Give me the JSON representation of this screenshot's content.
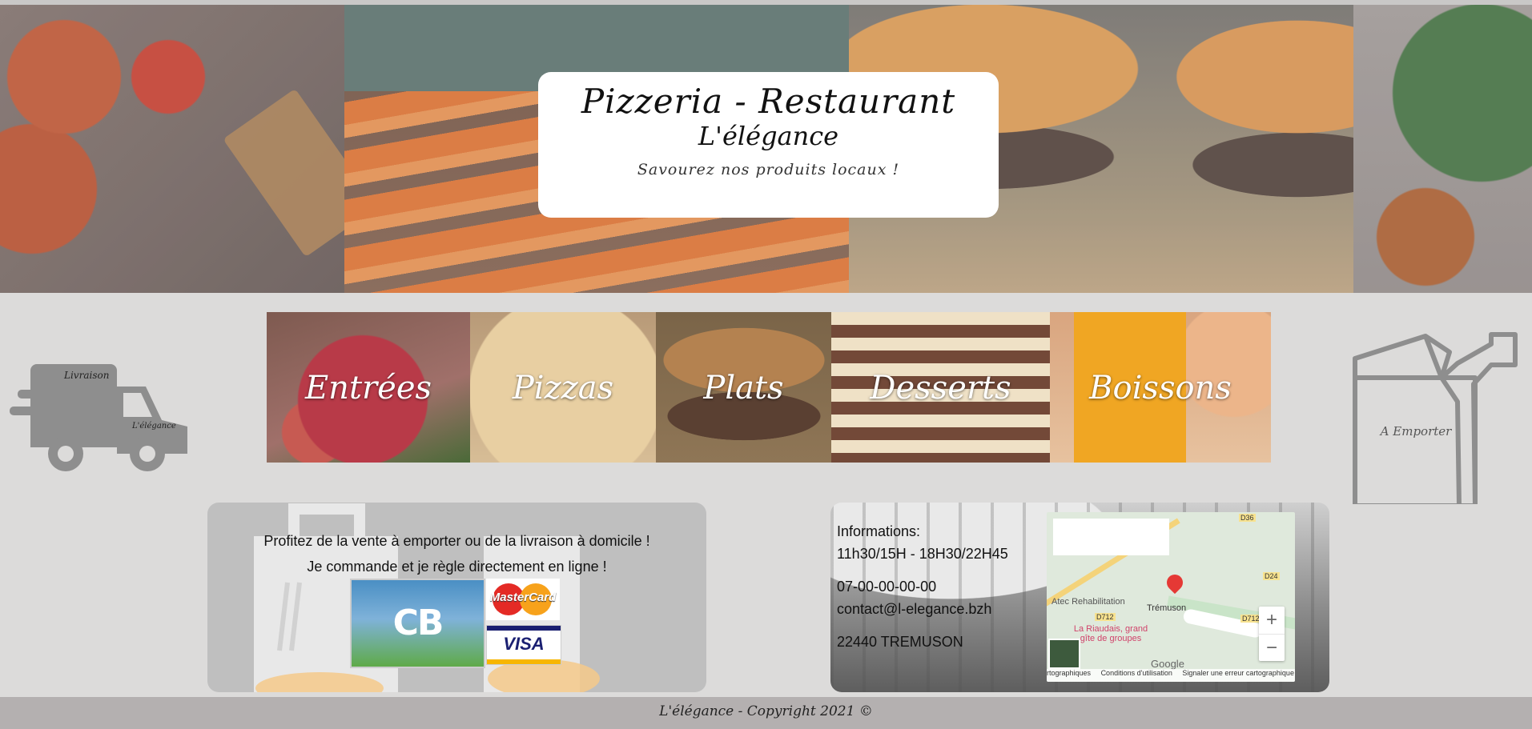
{
  "hero": {
    "title": "Pizzeria - Restaurant",
    "subtitle": "L'élégance",
    "tagline": "Savourez nos produits locaux !"
  },
  "categories": [
    {
      "label": "Entrées"
    },
    {
      "label": "Pizzas"
    },
    {
      "label": "Plats"
    },
    {
      "label": "Desserts"
    },
    {
      "label": "Boissons"
    }
  ],
  "delivery": {
    "line1": "Livraison",
    "line2": "L'élégance"
  },
  "takeaway": {
    "label": "A Emporter"
  },
  "order": {
    "line1": "Profitez de la vente à emporter ou de la livraison à domicile !",
    "line2": "Je commande et je règle directement en ligne !",
    "cards": {
      "cb": "CB",
      "mastercard": "MasterCard",
      "visa": "VISA"
    }
  },
  "info": {
    "heading": "Informations:",
    "hours": "11h30/15H - 18H30/22H45",
    "phone": "07-00-00-00-00",
    "email": "contact@l-elegance.bzh",
    "address": "22440 TREMUSON"
  },
  "map": {
    "labels": {
      "atec": "Atec Rehabilitation",
      "tremuson": "Trémuson",
      "gite": "La Riaudais, grand gîte de groupes",
      "d712a": "D712",
      "d712b": "D712",
      "d24": "D24",
      "d36": "D36"
    },
    "google": "Google",
    "zoom_in": "+",
    "zoom_out": "−",
    "footer": {
      "data": "rtographiques",
      "terms": "Conditions d'utilisation",
      "report": "Signaler une erreur cartographique"
    }
  },
  "footer": {
    "text": "L'élégance - Copyright 2021 ©"
  }
}
